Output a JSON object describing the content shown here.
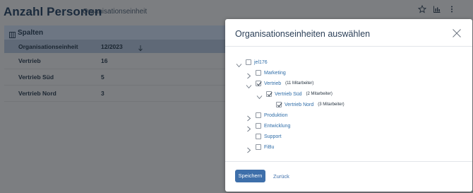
{
  "page": {
    "title": "Anzahl Personen",
    "subtitle": "Organisationseinheit",
    "columns_label": "Spalten",
    "table": {
      "headers": [
        "Organisationseinheit",
        "12/2023"
      ],
      "rows": [
        [
          "Vertrieb",
          "16"
        ],
        [
          "Vertrieb Süd",
          "5"
        ],
        [
          "Vertrieb Nord",
          "3"
        ]
      ]
    }
  },
  "modal": {
    "title": "Organisationseinheiten auswählen",
    "tree": [
      {
        "label": "jel176",
        "checked": false,
        "expanded": true,
        "count": ""
      },
      {
        "label": "Marketing",
        "checked": false,
        "expanded": false,
        "count": ""
      },
      {
        "label": "Vertrieb",
        "checked": true,
        "expanded": true,
        "count": "(11 Mitarbeiter)"
      },
      {
        "label": "Vertrieb Süd",
        "checked": true,
        "expanded": true,
        "count": "(2 Mitarbeiter)"
      },
      {
        "label": "Vertrieb Nord",
        "checked": true,
        "expanded": false,
        "count": "(3 Mitarbeiter)"
      },
      {
        "label": "Produktion",
        "checked": false,
        "expanded": false,
        "count": ""
      },
      {
        "label": "Entwicklung",
        "checked": false,
        "expanded": false,
        "count": ""
      },
      {
        "label": "Support",
        "checked": false,
        "expanded": false,
        "count": ""
      },
      {
        "label": "FiBu",
        "checked": false,
        "expanded": false,
        "count": ""
      }
    ],
    "save_label": "Speichern",
    "back_label": "Zurück"
  },
  "colors": {
    "accent": "#3e6faa",
    "link": "#2f6da8",
    "overlay": "#7c7e81"
  },
  "icons": [
    "star-icon",
    "chart-icon",
    "more-vertical-icon",
    "columns-icon",
    "sort-down-icon",
    "close-icon",
    "chevron-right-icon",
    "chevron-down-icon",
    "checkbox-icon"
  ]
}
